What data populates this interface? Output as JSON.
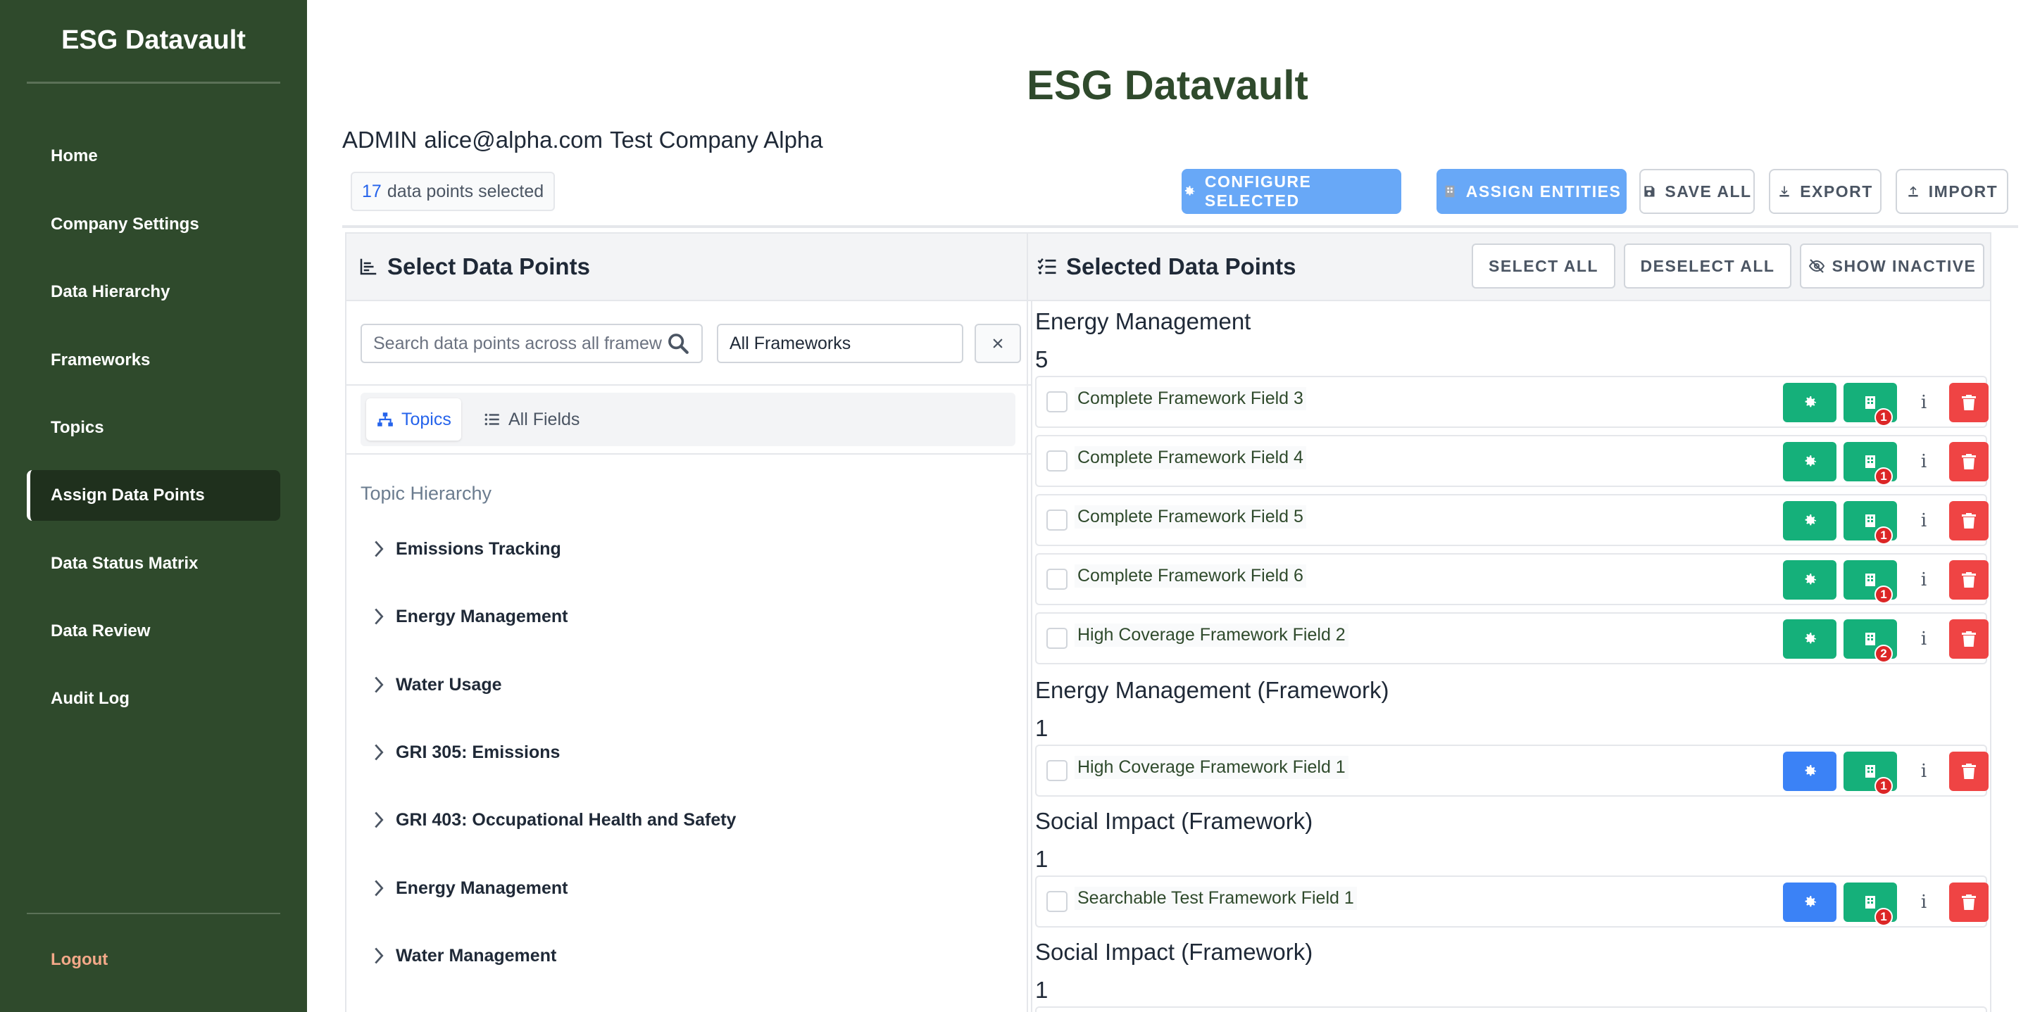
{
  "sidebar": {
    "brand": "ESG Datavault",
    "items": [
      {
        "label": "Home"
      },
      {
        "label": "Company Settings"
      },
      {
        "label": "Data Hierarchy"
      },
      {
        "label": "Frameworks"
      },
      {
        "label": "Topics"
      },
      {
        "label": "Assign Data Points"
      },
      {
        "label": "Data Status Matrix"
      },
      {
        "label": "Data Review"
      },
      {
        "label": "Audit Log"
      }
    ],
    "active_item": "Assign Data Points",
    "logout": "Logout"
  },
  "header": {
    "title": "ESG Datavault",
    "role": "ADMIN",
    "email": "alice@alpha.com",
    "company": "Test Company Alpha"
  },
  "toolbar": {
    "selected_count": "17",
    "selected_suffix": "data points selected",
    "configure_label": "CONFIGURE SELECTED",
    "assign_label": "ASSIGN ENTITIES",
    "save_label": "SAVE ALL",
    "export_label": "EXPORT",
    "import_label": "IMPORT"
  },
  "left_panel": {
    "title": "Select Data Points",
    "search_placeholder": "Search data points across all framew",
    "framework_select": "All Frameworks",
    "clear_icon": "close-icon",
    "tabs": [
      {
        "label": "Topics",
        "active": true
      },
      {
        "label": "All Fields",
        "active": false
      }
    ],
    "hierarchy_title": "Topic Hierarchy",
    "topics": [
      {
        "label": "Emissions Tracking"
      },
      {
        "label": "Energy Management"
      },
      {
        "label": "Water Usage"
      },
      {
        "label": "GRI 305: Emissions"
      },
      {
        "label": "GRI 403: Occupational Health and Safety"
      },
      {
        "label": "Energy Management"
      },
      {
        "label": "Water Management"
      }
    ]
  },
  "right_panel": {
    "title": "Selected Data Points",
    "select_all": "SELECT ALL",
    "deselect_all": "DESELECT ALL",
    "show_inactive": "SHOW INACTIVE",
    "info_glyph": "i",
    "groups": [
      {
        "title": "Energy Management",
        "count": "5",
        "items": [
          {
            "label": "Complete Framework Field 3",
            "entities": "1",
            "config_color": "#15b07a"
          },
          {
            "label": "Complete Framework Field 4",
            "entities": "1",
            "config_color": "#15b07a"
          },
          {
            "label": "Complete Framework Field 5",
            "entities": "1",
            "config_color": "#15b07a"
          },
          {
            "label": "Complete Framework Field 6",
            "entities": "1",
            "config_color": "#15b07a"
          },
          {
            "label": "High Coverage Framework Field 2",
            "entities": "2",
            "config_color": "#15b07a"
          }
        ]
      },
      {
        "title": "Energy Management (Framework)",
        "count": "1",
        "items": [
          {
            "label": "High Coverage Framework Field 1",
            "entities": "1",
            "config_color": "#3b82f6"
          }
        ]
      },
      {
        "title": "Social Impact (Framework)",
        "count": "1",
        "items": [
          {
            "label": "Searchable Test Framework Field 1",
            "entities": "1",
            "config_color": "#3b82f6"
          }
        ]
      },
      {
        "title": "Social Impact (Framework)",
        "count": "1",
        "items": []
      }
    ]
  },
  "colors": {
    "sidebar_bg": "#2f4a2c",
    "primary_button": "#68a8f7",
    "configured_green": "#15b07a",
    "unconfigured_blue": "#3b82f6",
    "delete_red": "#ef4444"
  }
}
